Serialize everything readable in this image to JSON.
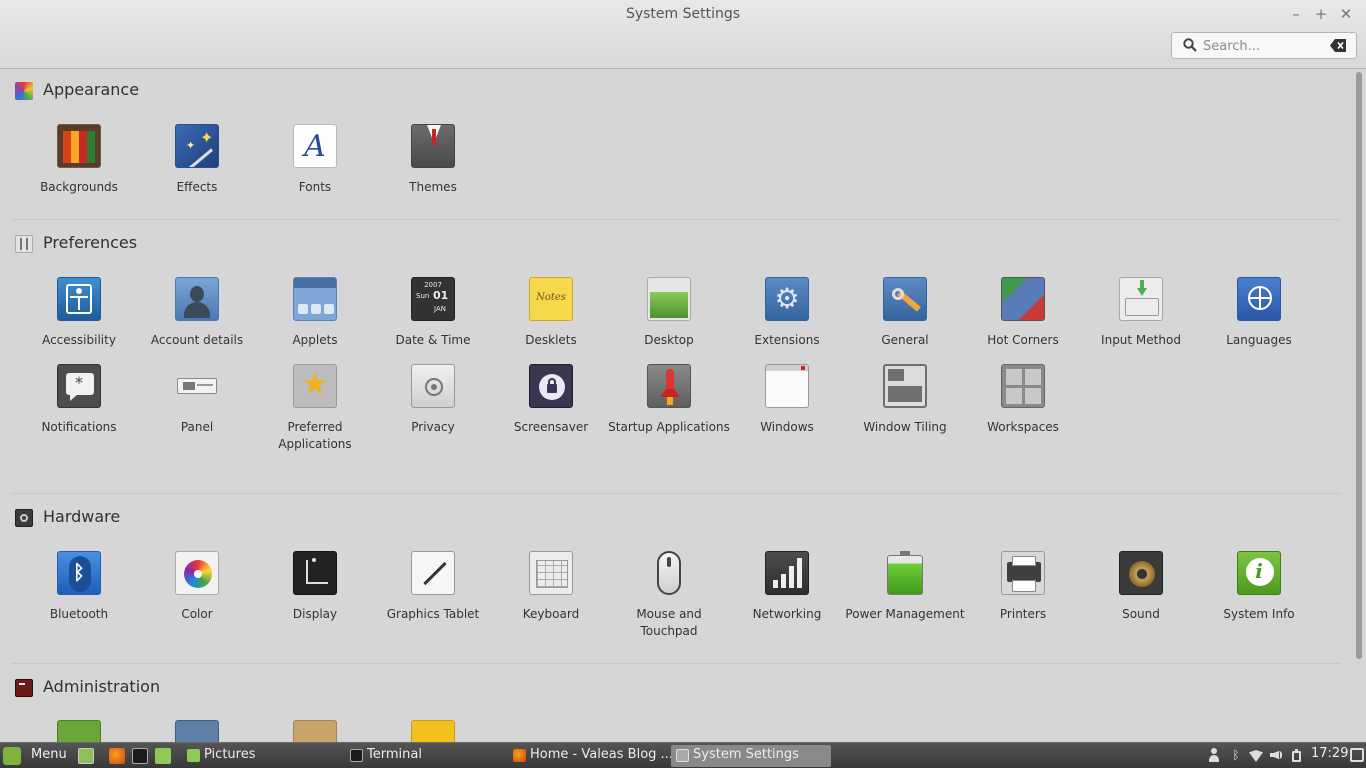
{
  "window": {
    "title": "System Settings",
    "controls": {
      "minimize": "–",
      "maximize": "+",
      "close": "✕"
    }
  },
  "search": {
    "placeholder": "Search...",
    "value": ""
  },
  "sections": [
    {
      "title": "Appearance",
      "icon": "appearance-icon",
      "items": [
        "Backgrounds",
        "Effects",
        "Fonts",
        "Themes"
      ]
    },
    {
      "title": "Preferences",
      "icon": "preferences-icon",
      "items": [
        "Accessibility",
        "Account details",
        "Applets",
        "Date & Time",
        "Desklets",
        "Desktop",
        "Extensions",
        "General",
        "Hot Corners",
        "Input Method",
        "Languages",
        "Notifications",
        "Panel",
        "Preferred Applications",
        "Privacy",
        "Screensaver",
        "Startup Applications",
        "Windows",
        "Window Tiling",
        "Workspaces"
      ]
    },
    {
      "title": "Hardware",
      "icon": "hardware-icon",
      "items": [
        "Bluetooth",
        "Color",
        "Display",
        "Graphics Tablet",
        "Keyboard",
        "Mouse and Touchpad",
        "Networking",
        "Power Management",
        "Printers",
        "Sound",
        "System Info"
      ]
    },
    {
      "title": "Administration",
      "icon": "administration-icon",
      "items": [
        "",
        "",
        "",
        ""
      ]
    }
  ],
  "icon_text": {
    "fonts": "A",
    "date_year": "2007",
    "date_day": "Sun",
    "date_num": "01",
    "date_month": "JAN",
    "desklets_note": "Notes"
  },
  "taskbar": {
    "menu_label": "Menu",
    "launchers": [
      "show-desktop-icon",
      "firefox-icon",
      "terminal-icon",
      "files-icon"
    ],
    "tasks": [
      {
        "label": "Pictures",
        "icon": "folder-icon",
        "active": false
      },
      {
        "label": "Terminal",
        "icon": "terminal-icon",
        "active": false
      },
      {
        "label": "Home - Valeas Blog ...",
        "icon": "firefox-icon",
        "active": false
      },
      {
        "label": "System Settings",
        "icon": "settings-icon",
        "active": true
      }
    ],
    "tray": [
      "user-icon",
      "bluetooth-icon",
      "wifi-icon",
      "volume-icon",
      "battery-icon"
    ],
    "clock": "17:29"
  },
  "colors": {
    "window_bg": "#d6d6d6",
    "taskbar": "#3f3f3f",
    "accent_green": "#7fb33d"
  }
}
